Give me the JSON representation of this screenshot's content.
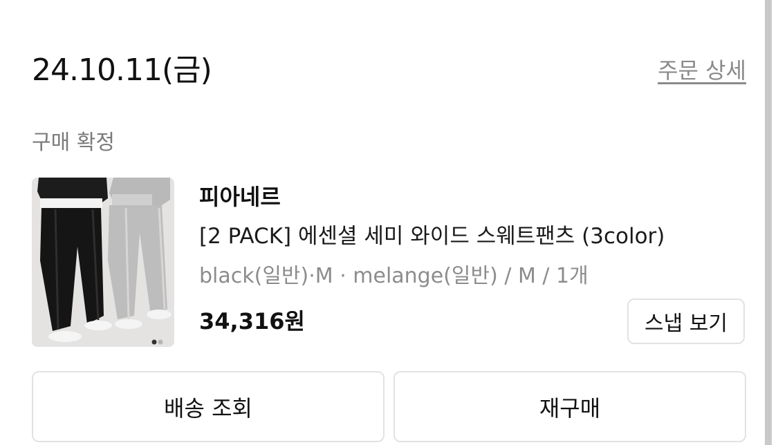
{
  "order": {
    "date": "24.10.11(금)",
    "detail_link": "주문 상세",
    "status": "구매 확정"
  },
  "product": {
    "brand": "피아네르",
    "name": "[2 PACK] 에센셜 세미 와이드 스웨트팬츠 (3color)",
    "option": "black(일반)·M · melange(일반) / M / 1개",
    "price": "34,316원",
    "image_icon": "product-photo-two-models-in-sweatpants",
    "carousel_dots": 2,
    "carousel_active_index": 0
  },
  "buttons": {
    "snap": "스냅 보기",
    "shipping": "배송 조회",
    "rebuy": "재구매"
  },
  "colors": {
    "text_primary": "#111111",
    "text_secondary": "#8c8c8c",
    "border": "#e2e2e2",
    "scrollbar": "#c9c9c9"
  }
}
